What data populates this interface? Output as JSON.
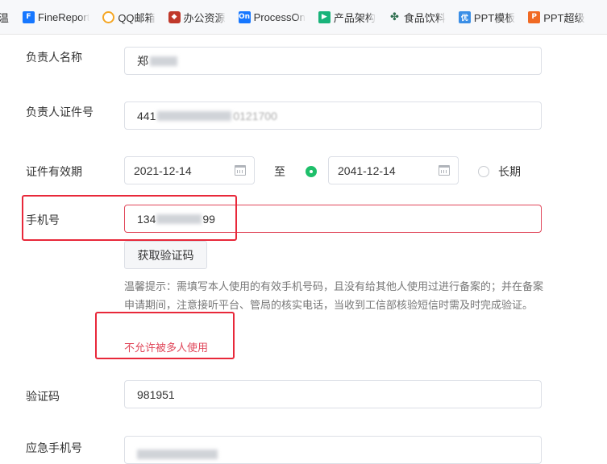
{
  "bookmarks": [
    {
      "label": "温頭",
      "icon": "clipped-icon",
      "color": "#c0392b"
    },
    {
      "label": "FineReport",
      "icon": "finereport-icon",
      "color": "#1677ff"
    },
    {
      "label": "QQ邮箱",
      "icon": "qq-mail-icon",
      "color": "#f5a623"
    },
    {
      "label": "办公资源",
      "icon": "office-resource-icon",
      "color": "#c0392b"
    },
    {
      "label": "ProcessOn",
      "icon": "processon-icon",
      "color": "#1677ff"
    },
    {
      "label": "产品架构",
      "icon": "play-icon",
      "color": "#19b37a"
    },
    {
      "label": "食品饮料",
      "icon": "plant-icon",
      "color": "#2f6f4f"
    },
    {
      "label": "PPT模板",
      "icon": "you-icon",
      "color": "#3a8ee6"
    },
    {
      "label": "PPT超级",
      "icon": "ppt-icon",
      "color": "#f06a24"
    }
  ],
  "form": {
    "owner_name": {
      "label": "负责人名称",
      "value": "郑"
    },
    "owner_id": {
      "label": "负责人证件号",
      "value_prefix": "441",
      "value_suffix": "0121700"
    },
    "validity": {
      "label": "证件有效期",
      "start": "2021-12-14",
      "separator": "至",
      "end": "2041-12-14",
      "long_term": "长期"
    },
    "mobile": {
      "label": "手机号",
      "value_prefix": "134",
      "value_suffix": "99"
    },
    "get_code_button": "获取验证码",
    "hint": "温馨提示：需填写本人使用的有效手机号码，且没有给其他人使用过进行备案的；并在备案申请期间，注意接听平台、管局的核实电话，当收到工信部核验短信时需及时完成验证。",
    "warning": "不允许被多人使用",
    "code": {
      "label": "验证码",
      "value": "981951"
    },
    "backup_mobile": {
      "label": "应急手机号"
    }
  },
  "colors": {
    "accent": "#1ebf6a",
    "error": "#e0475a",
    "annotation": "#e8283a"
  }
}
